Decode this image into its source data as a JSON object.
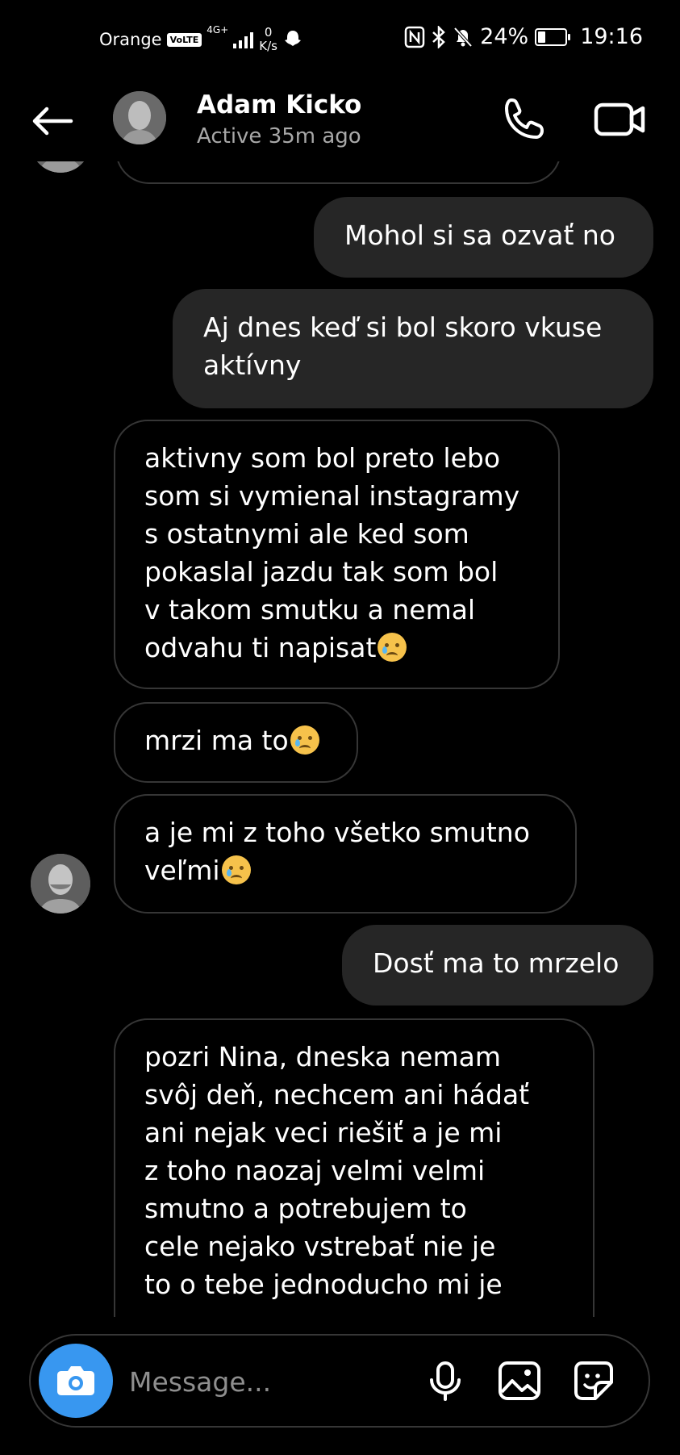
{
  "status_bar": {
    "carrier": "Orange",
    "volte_badge": "VoLTE",
    "network": "4G+",
    "speed_value": "0",
    "speed_unit": "K/s",
    "battery": "24%",
    "battery_level": 0.24,
    "time": "19:16"
  },
  "header": {
    "contact_name": "Adam Kicko",
    "active_status": "Active 35m ago"
  },
  "messages": [
    {
      "direction": "sent",
      "text": "Mohol si sa ozvať no"
    },
    {
      "direction": "sent",
      "lines": [
        "Aj dnes keď si bol skoro vkuse",
        "aktívny"
      ]
    },
    {
      "direction": "received",
      "lines": [
        "aktivny som bol preto lebo",
        "som si vymienal instagramy",
        "s ostatnymi ale ked som",
        "pokaslal jazdu tak som bol",
        "v takom smutku a nemal",
        "odvahu ti napisat"
      ],
      "emoji": "crying-face"
    },
    {
      "direction": "received",
      "lines": [
        "mrzi ma to"
      ],
      "emoji": "crying-face"
    },
    {
      "direction": "received",
      "lines": [
        "a je mi z toho všetko smutno",
        "veľmi"
      ],
      "emoji": "crying-face"
    },
    {
      "direction": "sent",
      "text": "Dosť ma to mrzelo"
    },
    {
      "direction": "received",
      "lines": [
        "pozri Nina, dneska nemam",
        "svôj deň, nechcem ani hádať",
        "ani nejak veci riešiť a je mi",
        "z toho naozaj velmi velmi",
        "smutno a potrebujem to",
        "cele nejako vstrebať nie je",
        "to o tebe jednoducho mi je"
      ]
    }
  ],
  "composer": {
    "placeholder": "Message..."
  },
  "icons": {
    "back": "arrow-left-icon",
    "call": "phone-icon",
    "video": "video-camera-icon",
    "camera": "camera-icon",
    "mic": "microphone-icon",
    "gallery": "image-icon",
    "sticker": "sticker-icon"
  },
  "colors": {
    "background": "#000000",
    "sent_bubble": "#262626",
    "received_border": "#363636",
    "accent": "#3897f0",
    "secondary_text": "#a8a8a8"
  }
}
